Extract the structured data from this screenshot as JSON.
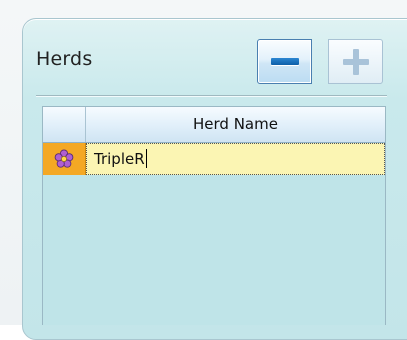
{
  "panel": {
    "title": "Herds"
  },
  "toolbar": {
    "remove_icon": "minus-icon",
    "add_icon": "plus-icon"
  },
  "grid": {
    "columns": [
      "",
      "Herd Name"
    ],
    "rows": [
      {
        "icon": "flower-icon",
        "herd_name": "TripleR",
        "editing": true
      }
    ]
  },
  "colors": {
    "panel_bg": "#c3e5e9",
    "row_indicator": "#f4a824",
    "edit_cell": "#fbf5b3",
    "minus_glyph": "#0e5fa8",
    "plus_glyph_disabled": "#a9c3d9"
  }
}
